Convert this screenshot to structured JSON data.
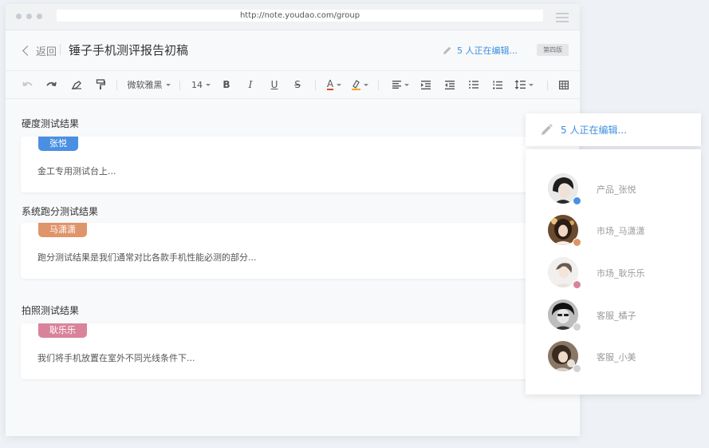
{
  "browser": {
    "url": "http://note.youdao.com/group"
  },
  "header": {
    "back_label": "返回",
    "doc_title": "锤子手机测评报告初稿",
    "editing_status": "5 人正在编辑...",
    "version_label": "第四版"
  },
  "toolbar": {
    "font_family": "微软雅黑",
    "font_size": "14",
    "bold_label": "B",
    "italic_label": "I",
    "underline_label": "U",
    "strike_label": "S",
    "font_color_label": "A",
    "font_color_accent": "#e0452f",
    "highlight_accent": "#f5a623"
  },
  "sections": [
    {
      "title": "硬度测试结果",
      "tag": "张悦",
      "tag_color": "#4a90e2",
      "text": "金工专用测试台上..."
    },
    {
      "title": "系统跑分测试结果",
      "tag": "马潇潇",
      "tag_color": "#e0946a",
      "text": "跑分测试结果是我们通常对比各款手机性能必测的部分..."
    },
    {
      "title": "拍照测试结果",
      "tag": "耿乐乐",
      "tag_color": "#d9839a",
      "text": "我们将手机放置在室外不同光线条件下..."
    }
  ],
  "editing_panel": {
    "status": "5 人正在编辑..."
  },
  "users": [
    {
      "name": "产品_张悦",
      "status_color": "#4a90e2",
      "avatar": "avatar-1"
    },
    {
      "name": "市场_马潇潇",
      "status_color": "#e0946a",
      "avatar": "avatar-2"
    },
    {
      "name": "市场_耿乐乐",
      "status_color": "#d9839a",
      "avatar": "avatar-3"
    },
    {
      "name": "客服_橘子",
      "status_color": "#cfd2d6",
      "avatar": "avatar-4"
    },
    {
      "name": "客服_小美",
      "status_color": "#cfd2d6",
      "avatar": "avatar-5"
    }
  ]
}
